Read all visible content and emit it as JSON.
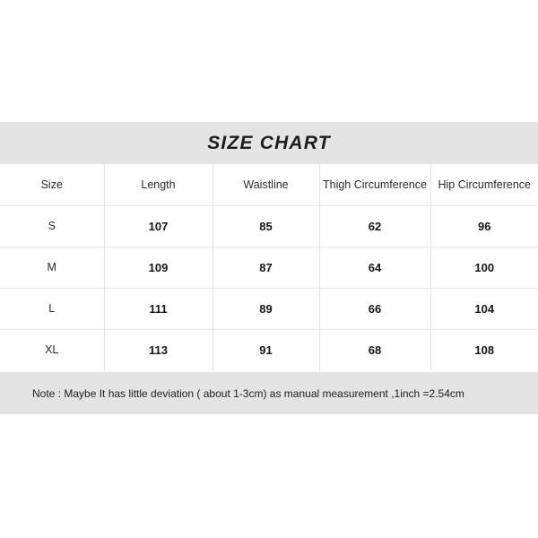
{
  "title": "SIZE CHART",
  "colors": {
    "band_background": "#e4e4e4",
    "page_background": "#ffffff",
    "grid_line": "#e6e6e6",
    "text": "#1d1d1d"
  },
  "table": {
    "headers": [
      "Size",
      "Length",
      "Waistline",
      "Thigh Circumference",
      "Hip Circumference"
    ],
    "rows": [
      {
        "size": "S",
        "length": "107",
        "waistline": "85",
        "thigh": "62",
        "hip": "96"
      },
      {
        "size": "M",
        "length": "109",
        "waistline": "87",
        "thigh": "64",
        "hip": "100"
      },
      {
        "size": "L",
        "length": "111",
        "waistline": "89",
        "thigh": "66",
        "hip": "104"
      },
      {
        "size": "XL",
        "length": "113",
        "waistline": "91",
        "thigh": "68",
        "hip": "108"
      }
    ]
  },
  "note": "Note : Maybe It has little deviation ( about 1-3cm) as manual measurement ,1inch =2.54cm"
}
